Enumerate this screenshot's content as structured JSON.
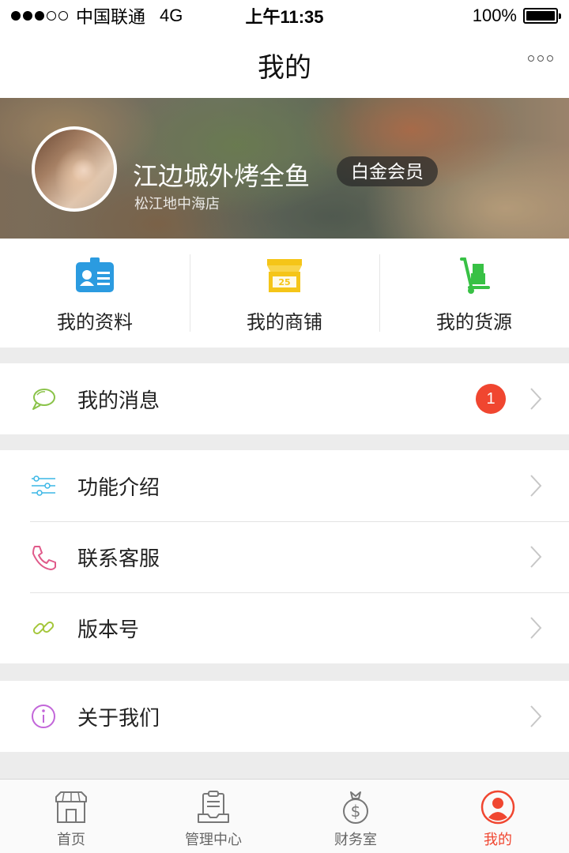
{
  "status_bar": {
    "carrier": "中国联通",
    "network": "4G",
    "time": "上午11:35",
    "battery": "100%"
  },
  "nav": {
    "title": "我的"
  },
  "profile": {
    "name": "江边城外烤全鱼",
    "membership": "白金会员",
    "store": "松江地中海店"
  },
  "quick_actions": [
    {
      "label": "我的资料",
      "icon": "id-card-icon"
    },
    {
      "label": "我的商铺",
      "icon": "shop-icon",
      "icon_text": "25"
    },
    {
      "label": "我的货源",
      "icon": "hand-truck-icon"
    }
  ],
  "menu": {
    "messages": {
      "label": "我的消息",
      "badge": "1"
    },
    "features": {
      "label": "功能介绍"
    },
    "support": {
      "label": "联系客服"
    },
    "version": {
      "label": "版本号"
    },
    "about": {
      "label": "关于我们"
    }
  },
  "tab_bar": [
    {
      "label": "首页",
      "icon": "storefront-icon"
    },
    {
      "label": "管理中心",
      "icon": "clipboard-icon"
    },
    {
      "label": "财务室",
      "icon": "money-bag-icon"
    },
    {
      "label": "我的",
      "icon": "user-icon",
      "active": true
    }
  ],
  "colors": {
    "accent": "#f04630",
    "id_card": "#2b9be0",
    "shop": "#f5c518",
    "truck": "#38c145",
    "message_icon": "#8bc34a",
    "features_icon": "#3bb7e6",
    "support_icon": "#e05a8a",
    "version_icon": "#a4c63a",
    "about_icon": "#c266d9"
  }
}
